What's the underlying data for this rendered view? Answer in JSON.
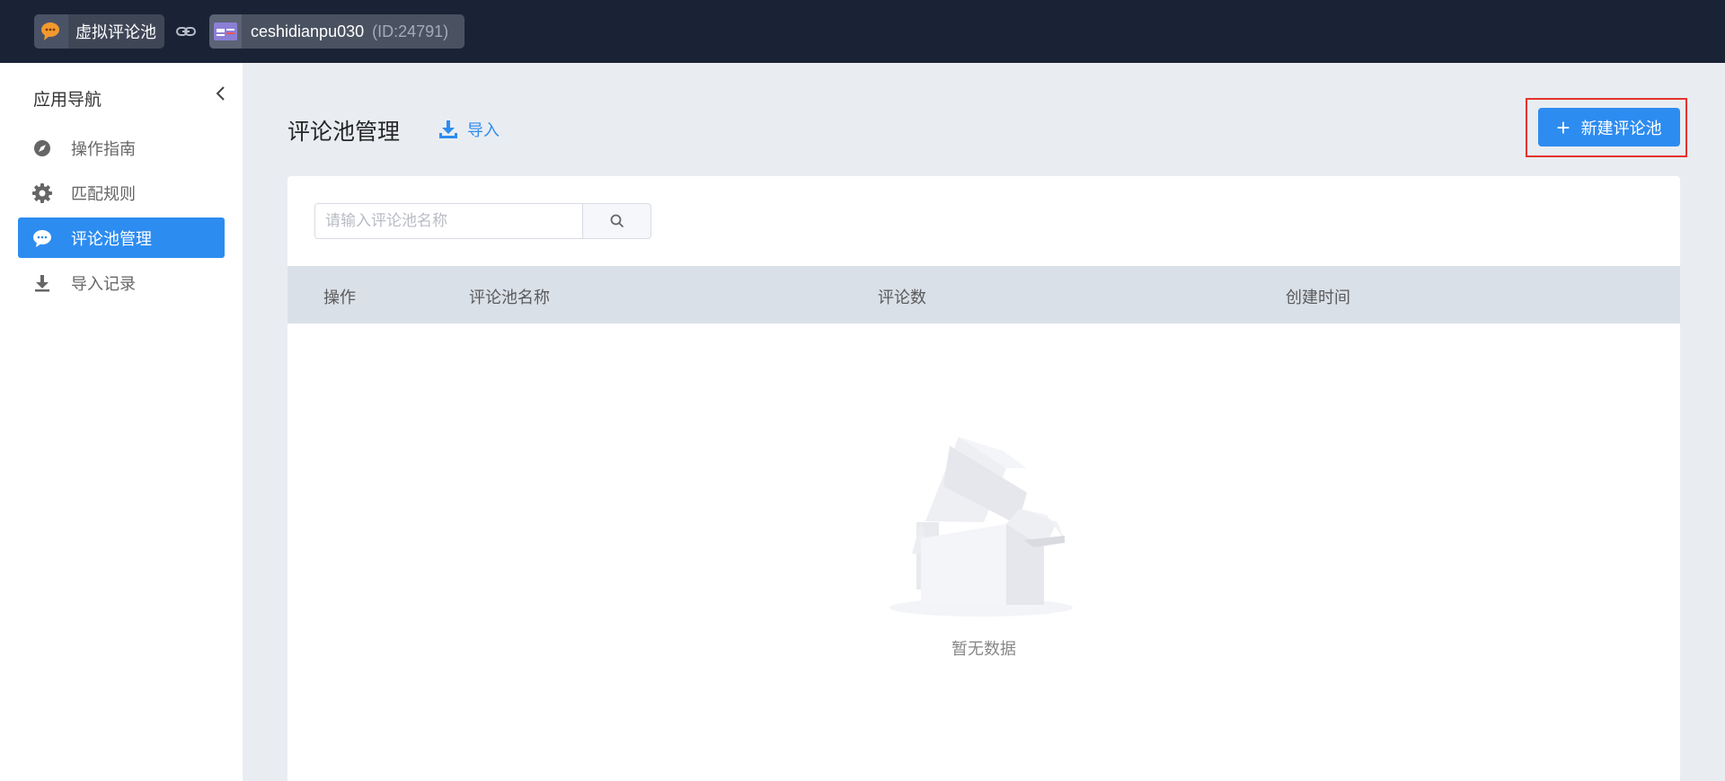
{
  "topbar": {
    "app_name": "虚拟评论池",
    "store_name": "ceshidianpu030",
    "store_id": "(ID:24791)"
  },
  "sidebar": {
    "title": "应用导航",
    "items": [
      {
        "label": "操作指南",
        "icon": "compass-icon",
        "active": false
      },
      {
        "label": "匹配规则",
        "icon": "gear-icon",
        "active": false
      },
      {
        "label": "评论池管理",
        "icon": "chat-bubble-icon",
        "active": true
      },
      {
        "label": "导入记录",
        "icon": "download-icon",
        "active": false
      }
    ]
  },
  "main": {
    "title": "评论池管理",
    "import_label": "导入",
    "new_button_label": "新建评论池",
    "search_placeholder": "请输入评论池名称",
    "columns": [
      "操作",
      "评论池名称",
      "评论数",
      "创建时间"
    ],
    "empty_text": "暂无数据"
  },
  "colors": {
    "topbar_bg": "#1a2236",
    "accent": "#2d8cf0",
    "highlight_border": "#e6322e"
  }
}
